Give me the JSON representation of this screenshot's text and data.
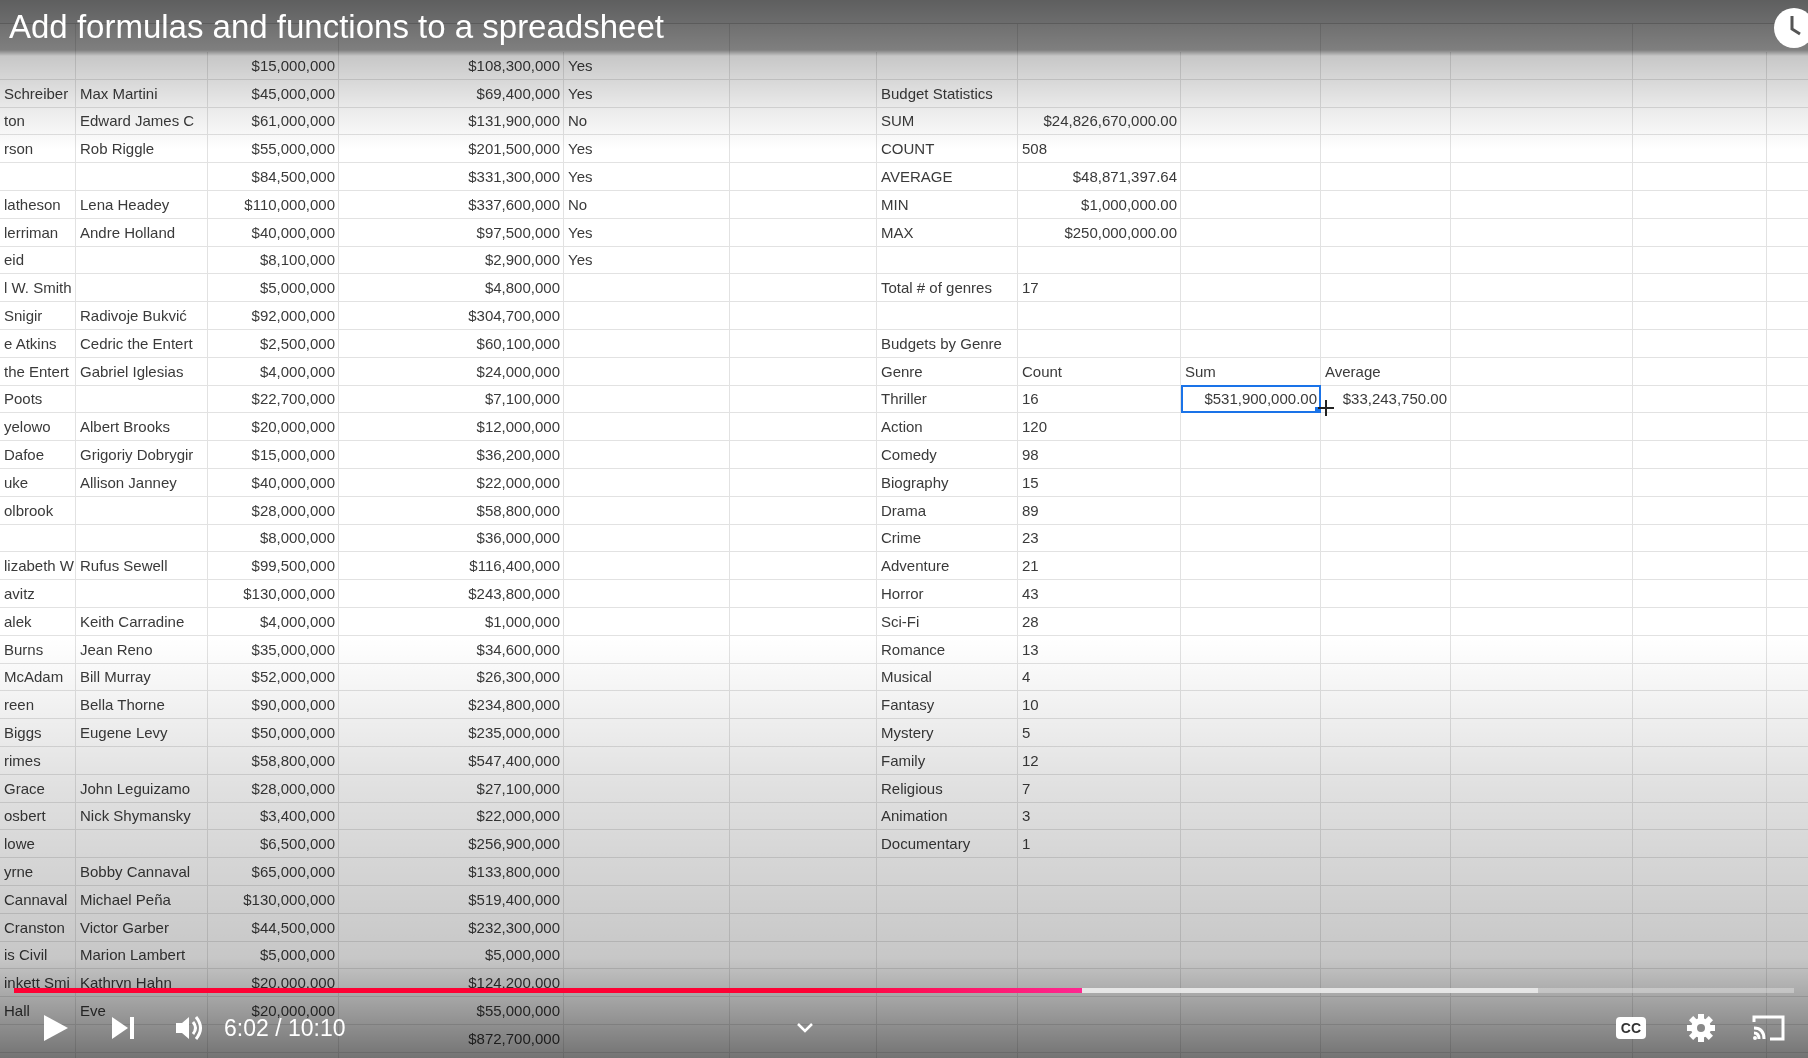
{
  "video": {
    "title": "Add formulas and functions to a spreadsheet",
    "paused": true,
    "time": "6:02 / 10:10",
    "captions": {
      "label": "CC",
      "on": false
    },
    "progress": {
      "level": 0.6
    },
    "buffer": {
      "level": 0.856
    }
  },
  "sheet": {
    "rows": [
      {
        "M": "$15,000,000",
        "N": "$108,300,000",
        "O": "Yes",
        "S_selected": false
      },
      {
        "K": "Schreiber",
        "L": "Max Martini",
        "M": "$45,000,000",
        "N": "$69,400,000",
        "O": "Yes",
        "Q": "Budget Statistics",
        "S_selected": false
      },
      {
        "K": "ton",
        "L": "Edward James C",
        "M": "$61,000,000",
        "N": "$131,900,000",
        "O": "No",
        "Q": "SUM",
        "R": "$24,826,670,000.00",
        "S_selected": false
      },
      {
        "K": "rson",
        "L": "Rob Riggle",
        "M": "$55,000,000",
        "N": "$201,500,000",
        "O": "Yes",
        "Q": "COUNT",
        "R": "508",
        "S_selected": false
      },
      {
        "M": "$84,500,000",
        "N": "$331,300,000",
        "O": "Yes",
        "Q": "AVERAGE",
        "R": "$48,871,397.64",
        "S_selected": false
      },
      {
        "K": "latheson",
        "L": "Lena Headey",
        "M": "$110,000,000",
        "N": "$337,600,000",
        "O": "No",
        "Q": "MIN",
        "R": "$1,000,000.00",
        "S_selected": false
      },
      {
        "K": "lerriman",
        "L": "Andre Holland",
        "M": "$40,000,000",
        "N": "$97,500,000",
        "O": "Yes",
        "Q": "MAX",
        "R": "$250,000,000.00",
        "S_selected": false
      },
      {
        "K": "eid",
        "M": "$8,100,000",
        "N": "$2,900,000",
        "O": "Yes",
        "S_selected": false
      },
      {
        "K": "l W. Smith",
        "M": "$5,000,000",
        "N": "$4,800,000",
        "Q": "Total # of genres",
        "R": "17",
        "S_selected": false
      },
      {
        "K": "Snigir",
        "L": "Radivoje Bukvić",
        "M": "$92,000,000",
        "N": "$304,700,000",
        "S_selected": false
      },
      {
        "K": "e Atkins",
        "L": "Cedric the Entert",
        "M": "$2,500,000",
        "N": "$60,100,000",
        "Q": "Budgets by Genre",
        "S_selected": false
      },
      {
        "K": "the Entert",
        "L": "Gabriel Iglesias",
        "M": "$4,000,000",
        "N": "$24,000,000",
        "Q": "Genre",
        "R": "Count",
        "S": "Sum",
        "T": "Average",
        "S_selected": false
      },
      {
        "K": "Poots",
        "M": "$22,700,000",
        "N": "$7,100,000",
        "Q": "Thriller",
        "R": "16",
        "S": "$531,900,000.00",
        "T": "$33,243,750.00",
        "S_selected": true
      },
      {
        "K": "yelowo",
        "L": "Albert Brooks",
        "M": "$20,000,000",
        "N": "$12,000,000",
        "Q": "Action",
        "R": "120",
        "S_selected": false
      },
      {
        "K": "Dafoe",
        "L": "Grigoriy Dobrygir",
        "M": "$15,000,000",
        "N": "$36,200,000",
        "Q": "Comedy",
        "R": "98",
        "S_selected": false
      },
      {
        "K": "uke",
        "L": "Allison Janney",
        "M": "$40,000,000",
        "N": "$22,000,000",
        "Q": "Biography",
        "R": "15",
        "S_selected": false
      },
      {
        "K": "olbrook",
        "M": "$28,000,000",
        "N": "$58,800,000",
        "Q": "Drama",
        "R": "89",
        "S_selected": false
      },
      {
        "M": "$8,000,000",
        "N": "$36,000,000",
        "Q": "Crime",
        "R": "23",
        "S_selected": false
      },
      {
        "K": "lizabeth W",
        "L": "Rufus Sewell",
        "M": "$99,500,000",
        "N": "$116,400,000",
        "Q": "Adventure",
        "R": "21",
        "S_selected": false
      },
      {
        "K": "avitz",
        "M": "$130,000,000",
        "N": "$243,800,000",
        "Q": "Horror",
        "R": "43",
        "S_selected": false
      },
      {
        "K": "alek",
        "L": "Keith Carradine",
        "M": "$4,000,000",
        "N": "$1,000,000",
        "Q": "Sci-Fi",
        "R": "28",
        "S_selected": false
      },
      {
        "K": "Burns",
        "L": "Jean Reno",
        "M": "$35,000,000",
        "N": "$34,600,000",
        "Q": "Romance",
        "R": "13",
        "S_selected": false
      },
      {
        "K": "McAdam",
        "L": "Bill Murray",
        "M": "$52,000,000",
        "N": "$26,300,000",
        "Q": "Musical",
        "R": "4",
        "S_selected": false
      },
      {
        "K": "reen",
        "L": "Bella Thorne",
        "M": "$90,000,000",
        "N": "$234,800,000",
        "Q": "Fantasy",
        "R": "10",
        "S_selected": false
      },
      {
        "K": "Biggs",
        "L": "Eugene Levy",
        "M": "$50,000,000",
        "N": "$235,000,000",
        "Q": "Mystery",
        "R": "5",
        "S_selected": false
      },
      {
        "K": "rimes",
        "M": "$58,800,000",
        "N": "$547,400,000",
        "Q": "Family",
        "R": "12",
        "S_selected": false
      },
      {
        "K": "Grace",
        "L": "John Leguizamo",
        "M": "$28,000,000",
        "N": "$27,100,000",
        "Q": "Religious",
        "R": "7",
        "S_selected": false
      },
      {
        "K": "osbert",
        "L": "Nick Shymansky",
        "M": "$3,400,000",
        "N": "$22,000,000",
        "Q": "Animation",
        "R": "3",
        "S_selected": false
      },
      {
        "K": "lowe",
        "M": "$6,500,000",
        "N": "$256,900,000",
        "Q": "Documentary",
        "R": "1",
        "S_selected": false
      },
      {
        "K": "yrne",
        "L": "Bobby Cannaval",
        "M": "$65,000,000",
        "N": "$133,800,000",
        "S_selected": false
      },
      {
        "K": "Cannaval",
        "L": "Michael Peña",
        "M": "$130,000,000",
        "N": "$519,400,000",
        "S_selected": false
      },
      {
        "K": "Cranston",
        "L": "Victor Garber",
        "M": "$44,500,000",
        "N": "$232,300,000",
        "S_selected": false
      },
      {
        "K": "is Civil",
        "L": "Marion Lambert",
        "M": "$5,000,000",
        "N": "$5,000,000",
        "S_selected": false
      },
      {
        "K": "inkett Smi",
        "L": "Kathryn Hahn",
        "M": "$20,000,000",
        "N": "$124,200,000",
        "S_selected": false
      },
      {
        "K": "Hall",
        "L": "Eve",
        "M": "$20,000,000",
        "N": "$55,000,000",
        "S_selected": false
      },
      {
        "N": "$872,700,000",
        "S_selected": false
      }
    ]
  }
}
